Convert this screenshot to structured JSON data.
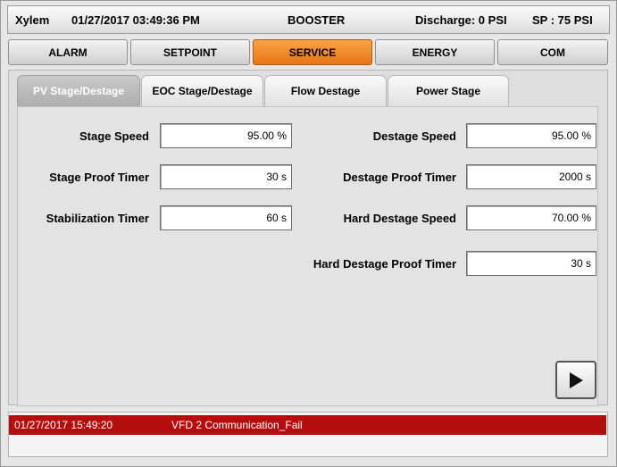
{
  "header": {
    "brand": "Xylem",
    "datetime": "01/27/2017 03:49:36 PM",
    "mode": "BOOSTER",
    "discharge": "Discharge: 0 PSI",
    "setpoint": "SP : 75 PSI"
  },
  "nav": [
    {
      "label": "ALARM",
      "active": false
    },
    {
      "label": "SETPOINT",
      "active": false
    },
    {
      "label": "SERVICE",
      "active": true
    },
    {
      "label": "ENERGY",
      "active": false
    },
    {
      "label": "COM",
      "active": false
    }
  ],
  "subtabs": [
    {
      "label": "PV Stage/Destage",
      "active": true
    },
    {
      "label": "EOC Stage/Destage",
      "active": false
    },
    {
      "label": "Flow Destage",
      "active": false
    },
    {
      "label": "Power Stage",
      "active": false
    }
  ],
  "stage": {
    "stage_speed_label": "Stage Speed",
    "stage_speed_value": "95.00 %",
    "stage_proof_label": "Stage Proof Timer",
    "stage_proof_value": "30 s",
    "stabilization_label": "Stabilization Timer",
    "stabilization_value": "60 s"
  },
  "destage": {
    "destage_speed_label": "Destage Speed",
    "destage_speed_value": "95.00 %",
    "destage_proof_label": "Destage Proof Timer",
    "destage_proof_value": "2000 s",
    "hard_speed_label": "Hard Destage Speed",
    "hard_speed_value": "70.00 %",
    "hard_proof_label": "Hard Destage Proof Timer",
    "hard_proof_value": "30 s"
  },
  "alarm": {
    "timestamp": "01/27/2017 15:49:20",
    "message": "VFD 2 Communication_Fail",
    "color": "#b30d0d"
  },
  "accent": "#f08c2a"
}
